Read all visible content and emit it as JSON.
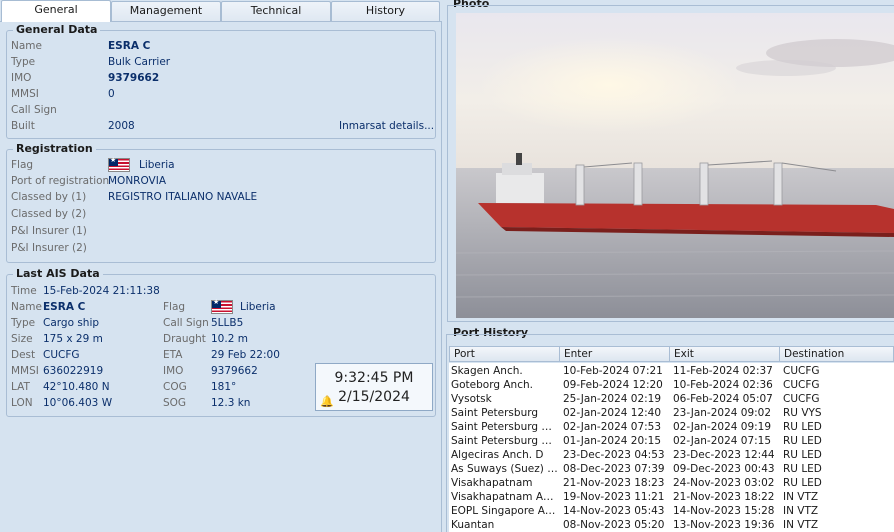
{
  "tabs": [
    {
      "label": "General"
    },
    {
      "label": "Management"
    },
    {
      "label": "Technical"
    },
    {
      "label": "History"
    }
  ],
  "general": {
    "title": "General Data",
    "name_label": "Name",
    "name": "ESRA C",
    "type_label": "Type",
    "type": "Bulk Carrier",
    "imo_label": "IMO",
    "imo": "9379662",
    "mmsi_label": "MMSI",
    "mmsi": "0",
    "callsign_label": "Call Sign",
    "callsign": "",
    "built_label": "Built",
    "built": "2008",
    "inmarsat_link": "Inmarsat details..."
  },
  "registration": {
    "title": "Registration",
    "flag_label": "Flag",
    "flag": "Liberia",
    "port_label": "Port of registration",
    "port": "MONROVIA",
    "class1_label": "Classed by (1)",
    "class1": "REGISTRO ITALIANO NAVALE",
    "class2_label": "Classed by (2)",
    "class2": "",
    "pi1_label": "P&I Insurer (1)",
    "pi1": "",
    "pi2_label": "P&I Insurer (2)",
    "pi2": ""
  },
  "ais": {
    "title": "Last AIS Data",
    "time_label": "Time",
    "time": "15-Feb-2024 21:11:38",
    "name_label": "Name",
    "name": "ESRA C",
    "type_label": "Type",
    "type": "Cargo ship",
    "size_label": "Size",
    "size": "175 x 29 m",
    "dest_label": "Dest",
    "dest": "CUCFG",
    "mmsi_label": "MMSI",
    "mmsi": "636022919",
    "lat_label": "LAT",
    "lat": "42°10.480 N",
    "lon_label": "LON",
    "lon": "10°06.403 W",
    "flag_label": "Flag",
    "flag": "Liberia",
    "callsign_label": "Call Sign",
    "callsign": "5LLB5",
    "draught_label": "Draught",
    "draught": "10.2 m",
    "eta_label": "ETA",
    "eta": "29 Feb 22:00",
    "imo_label": "IMO",
    "imo": "9379662",
    "cog_label": "COG",
    "cog": "181°",
    "sog_label": "SOG",
    "sog": "12.3 kn"
  },
  "clock": {
    "time": "9:32:45 PM",
    "date": "2/15/2024"
  },
  "photo": {
    "title": "Photo"
  },
  "port_history": {
    "title": "Port History",
    "columns": [
      "Port",
      "Enter",
      "Exit",
      "Destination"
    ],
    "rows": [
      [
        "Skagen Anch.",
        "10-Feb-2024 07:21",
        "11-Feb-2024 02:37",
        "CUCFG"
      ],
      [
        "Goteborg Anch.",
        "09-Feb-2024 12:20",
        "10-Feb-2024 02:36",
        "CUCFG"
      ],
      [
        "Vysotsk",
        "25-Jan-2024 02:19",
        "06-Feb-2024 05:07",
        "CUCFG"
      ],
      [
        "Saint Petersburg",
        "02-Jan-2024 12:40",
        "23-Jan-2024 09:02",
        "RU VYS"
      ],
      [
        "Saint Petersburg An...",
        "02-Jan-2024 07:53",
        "02-Jan-2024 09:19",
        "RU LED"
      ],
      [
        "Saint Petersburg An...",
        "01-Jan-2024 20:15",
        "02-Jan-2024 07:15",
        "RU LED"
      ],
      [
        "Algeciras Anch. D",
        "23-Dec-2023 04:53",
        "23-Dec-2023 12:44",
        "RU LED"
      ],
      [
        "As Suways (Suez) A...",
        "08-Dec-2023 07:39",
        "09-Dec-2023 00:43",
        "RU LED"
      ],
      [
        "Visakhapatnam",
        "21-Nov-2023 18:23",
        "24-Nov-2023 03:02",
        "RU LED"
      ],
      [
        "Visakhapatnam Anch.",
        "19-Nov-2023 11:21",
        "21-Nov-2023 18:22",
        "IN VTZ"
      ],
      [
        "EOPL Singapore Anch.",
        "14-Nov-2023 05:43",
        "14-Nov-2023 15:28",
        "IN VTZ"
      ],
      [
        "Kuantan",
        "08-Nov-2023 05:20",
        "13-Nov-2023 19:36",
        "IN VTZ"
      ]
    ]
  }
}
